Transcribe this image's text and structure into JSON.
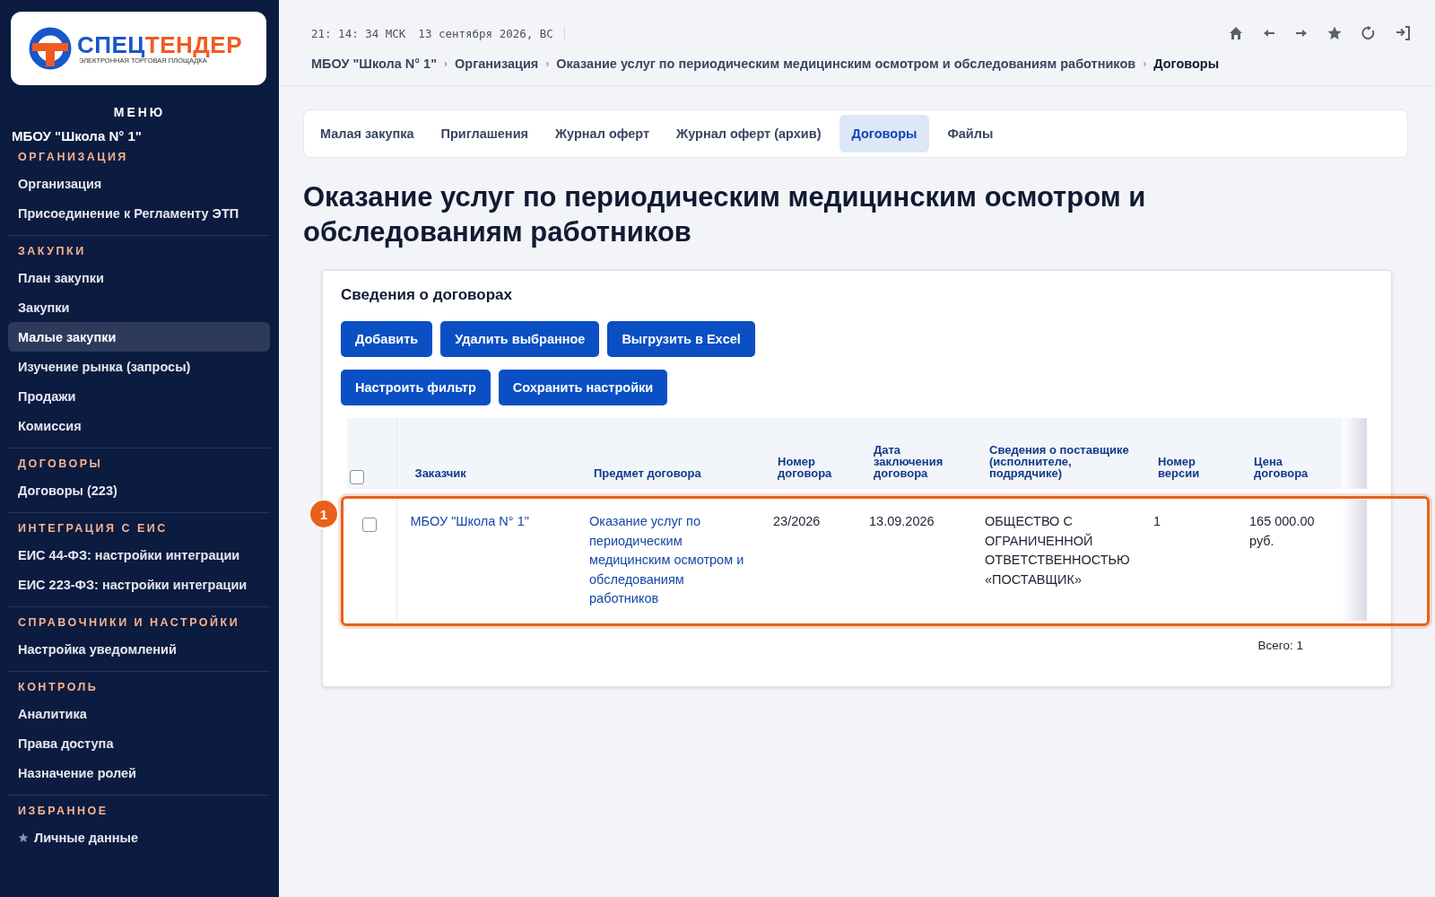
{
  "sidebar": {
    "logo": {
      "word_first": "СПЕЦ",
      "word_second": "ТЕНДЕР",
      "tagline": "ЭЛЕКТРОННАЯ ТОРГОВАЯ ПЛОЩАДКА"
    },
    "menu_title": "МЕНЮ",
    "organization": "МБОУ \"Школа N° 1\"",
    "sections": [
      {
        "title": "ОРГАНИЗАЦИЯ",
        "items": [
          {
            "label": "Организация",
            "selected": false,
            "kind": "plain"
          },
          {
            "label": "Присоединение к Регламенту ЭТП",
            "selected": false,
            "kind": "plain"
          }
        ]
      },
      {
        "title": "ЗАКУПКИ",
        "items": [
          {
            "label": "План закупки",
            "selected": false,
            "kind": "plain"
          },
          {
            "label": "Закупки",
            "selected": false,
            "kind": "plain"
          },
          {
            "label": "Малые закупки",
            "selected": true,
            "kind": "plain"
          },
          {
            "label": "Изучение рынка (запросы)",
            "selected": false,
            "kind": "plain"
          },
          {
            "label": "Продажи",
            "selected": false,
            "kind": "plain"
          },
          {
            "label": "Комиссия",
            "selected": false,
            "kind": "plain"
          }
        ]
      },
      {
        "title": "ДОГОВОРЫ",
        "items": [
          {
            "label": "Договоры (223)",
            "selected": false,
            "kind": "plain"
          }
        ]
      },
      {
        "title": "ИНТЕГРАЦИЯ С ЕИС",
        "items": [
          {
            "label": "ЕИС 44-ФЗ: настройки интеграции",
            "selected": false,
            "kind": "plain"
          },
          {
            "label": "ЕИС 223-ФЗ: настройки интеграции",
            "selected": false,
            "kind": "plain"
          }
        ]
      },
      {
        "title": "СПРАВОЧНИКИ И НАСТРОЙКИ",
        "items": [
          {
            "label": "Настройка уведомлений",
            "selected": false,
            "kind": "plain"
          }
        ]
      },
      {
        "title": "КОНТРОЛЬ",
        "items": [
          {
            "label": "Аналитика",
            "selected": false,
            "kind": "plain"
          },
          {
            "label": "Права доступа",
            "selected": false,
            "kind": "plain"
          },
          {
            "label": "Назначение ролей",
            "selected": false,
            "kind": "plain"
          }
        ]
      },
      {
        "title": "ИЗБРАННОЕ",
        "items": [
          {
            "label": "Личные данные",
            "selected": false,
            "kind": "favorite"
          }
        ]
      }
    ]
  },
  "header": {
    "clock": "21: 14: 34 МСК",
    "date": "13 сентября 2026, ВС",
    "breadcrumbs": [
      {
        "label": "МБОУ \"Школа N° 1\"",
        "current": false
      },
      {
        "separator": "›",
        "label": "Организация",
        "current": false
      },
      {
        "separator": "›",
        "label": "Оказание услуг по периодическим медицинским осмотром и обследованиям работников",
        "current": false
      },
      {
        "separator": "›",
        "label": "Договоры",
        "current": true
      }
    ]
  },
  "tabs": [
    {
      "label": "Малая закупка",
      "selected": false
    },
    {
      "label": "Приглашения",
      "selected": false
    },
    {
      "label": "Журнал оферт",
      "selected": false
    },
    {
      "label": "Журнал оферт (архив)",
      "selected": false
    },
    {
      "label": "Договоры",
      "selected": true
    },
    {
      "label": "Файлы",
      "selected": false
    }
  ],
  "page_title": "Оказание услуг по периодическим медицинским осмотром и обследованиям работников",
  "panel": {
    "title": "Сведения о договорах",
    "button_rows": [
      [
        "Добавить",
        "Удалить выбранное",
        "Выгрузить в Excel"
      ],
      [
        "Настроить фильтр",
        "Сохранить настройки"
      ]
    ],
    "table": {
      "select_all_checked": false,
      "columns": [
        "Заказчик",
        "Предмет договора",
        "Номер договора",
        "Дата заключения договора",
        "Сведения о поставщике (исполнителе, подрядчике)",
        "Номер версии",
        "Цена договора"
      ],
      "rows": [
        {
          "checked": false,
          "highlighted": true,
          "cells": [
            {
              "text": "МБОУ \"Школа N° 1\"",
              "kind": "link"
            },
            {
              "text": "Оказание услуг по периодическим медицинским осмотром и обследованиям работников",
              "kind": "link"
            },
            {
              "text": "23/2026",
              "kind": "text"
            },
            {
              "text": "13.09.2026",
              "kind": "text"
            },
            {
              "text": "ОБЩЕСТВО С ОГРАНИЧЕННОЙ ОТВЕТСТВЕННОСТЬЮ «ПОСТАВЩИК»",
              "kind": "text"
            },
            {
              "text": "1",
              "kind": "text"
            },
            {
              "text": "165 000.00 руб.",
              "kind": "text"
            }
          ]
        }
      ]
    },
    "total": "Всего: 1"
  },
  "annotation": {
    "number": "1"
  }
}
